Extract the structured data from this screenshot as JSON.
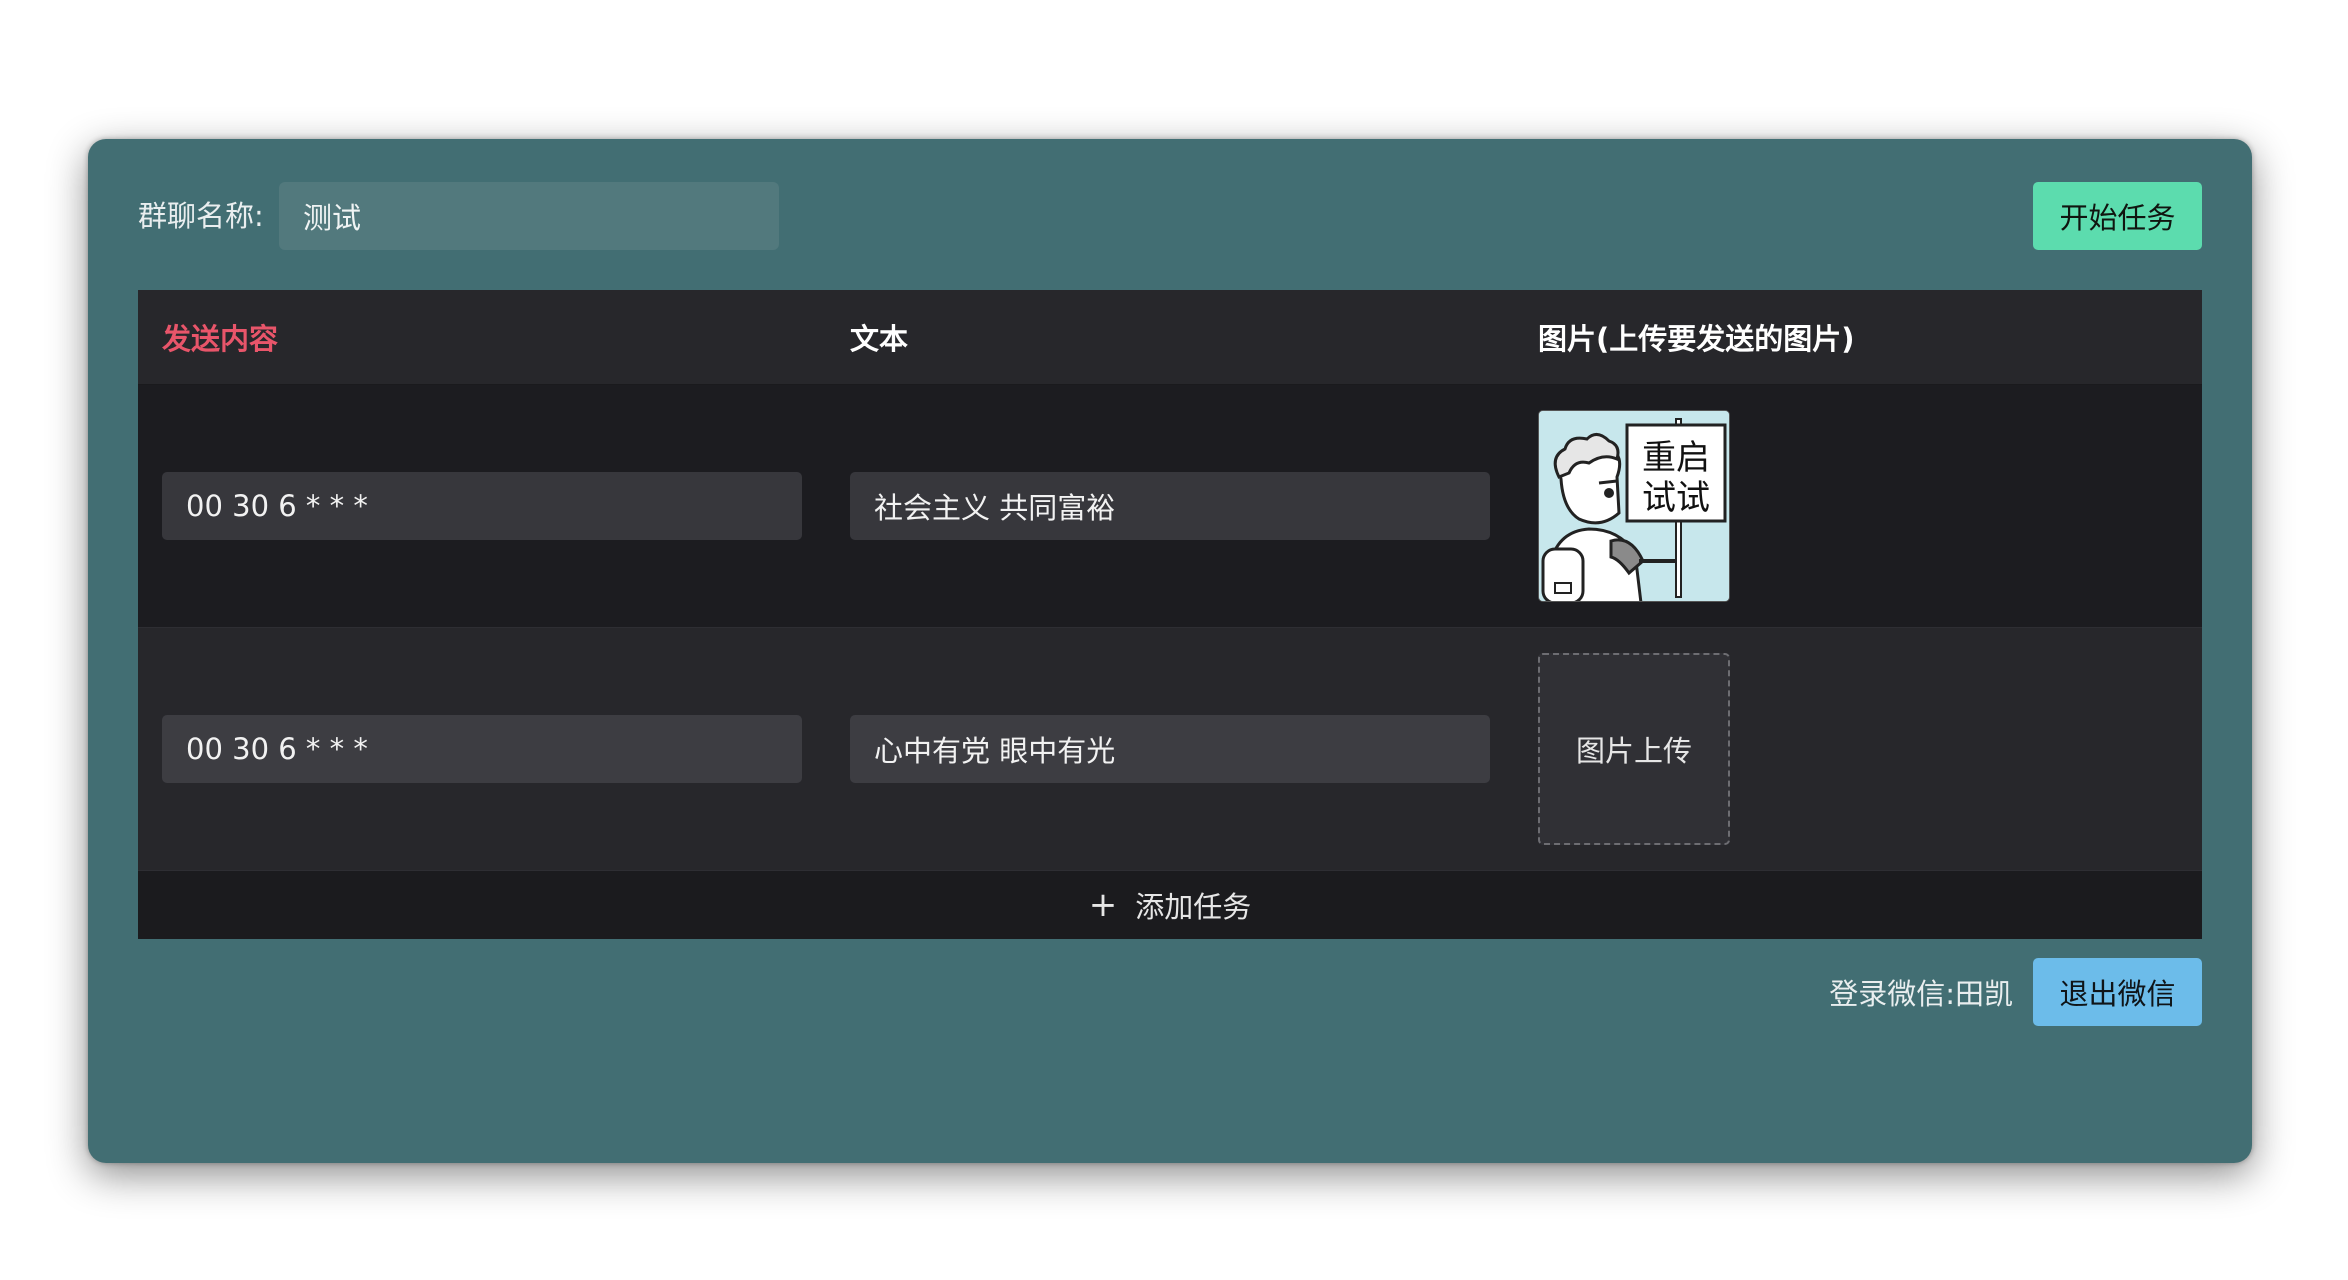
{
  "header": {
    "group_label": "群聊名称:",
    "group_value": "测试",
    "start_button": "开始任务"
  },
  "table": {
    "columns": [
      "发送内容",
      "文本",
      "图片(上传要发送的图片)"
    ],
    "rows": [
      {
        "cron": "00 30 6 * * *",
        "text": "社会主义 共同富裕",
        "image": {
          "type": "sticker",
          "caption_line1": "重启",
          "caption_line2": "试试"
        }
      },
      {
        "cron": "00 30 6 * * *",
        "text": "心中有党 眼中有光",
        "image": {
          "type": "upload",
          "label": "图片上传"
        }
      }
    ],
    "add_task": "添加任务"
  },
  "footer": {
    "login_label": "登录微信:",
    "login_name": "田凯",
    "logout_button": "退出微信"
  },
  "colors": {
    "window_bg": "#426e73",
    "start_button": "#5cdcae",
    "logout_button": "#6cbcea",
    "highlight_header": "#e8556a"
  }
}
